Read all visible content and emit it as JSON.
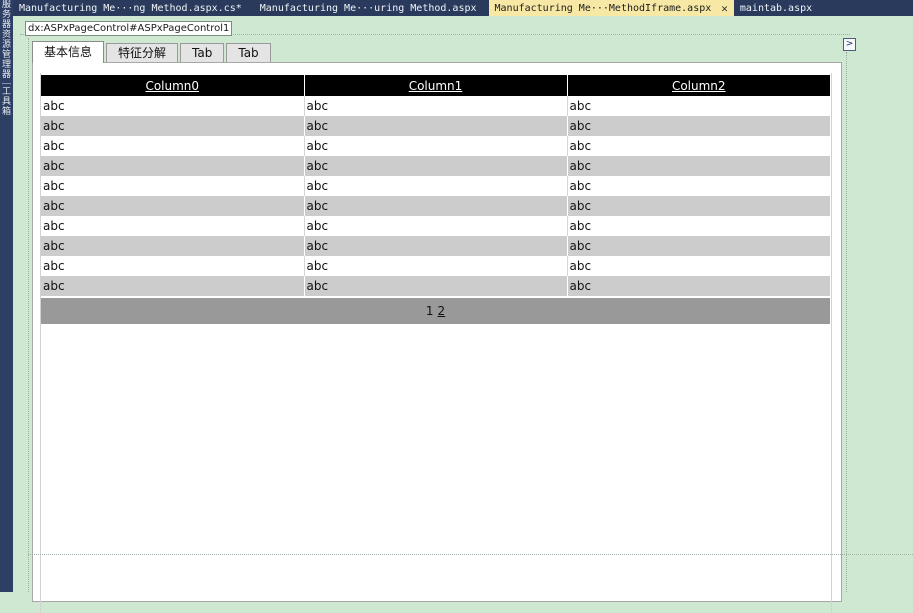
{
  "doc_tabs": [
    {
      "label": "Manufacturing Me···ng Method.aspx.cs*"
    },
    {
      "label": "Manufacturing Me···uring Method.aspx"
    },
    {
      "label": "Manufacturing Me···MethodIframe.aspx",
      "close": "✕"
    },
    {
      "label": "maintab.aspx"
    }
  ],
  "left_strip": {
    "glyphs": [
      "服",
      "务",
      "器",
      "资",
      "源",
      "管",
      "理",
      "器",
      "工",
      "具",
      "箱"
    ]
  },
  "design": {
    "control_label": "dx:ASPxPageControl#ASPxPageControl1",
    "smart_tag": ">"
  },
  "page_control": {
    "tabs": [
      "基本信息",
      "特征分解",
      "Tab",
      "Tab"
    ]
  },
  "grid": {
    "columns": [
      "Column0",
      "Column1",
      "Column2"
    ],
    "rows": [
      [
        "abc",
        "abc",
        "abc"
      ],
      [
        "abc",
        "abc",
        "abc"
      ],
      [
        "abc",
        "abc",
        "abc"
      ],
      [
        "abc",
        "abc",
        "abc"
      ],
      [
        "abc",
        "abc",
        "abc"
      ],
      [
        "abc",
        "abc",
        "abc"
      ],
      [
        "abc",
        "abc",
        "abc"
      ],
      [
        "abc",
        "abc",
        "abc"
      ],
      [
        "abc",
        "abc",
        "abc"
      ],
      [
        "abc",
        "abc",
        "abc"
      ]
    ],
    "pager": {
      "current": "1",
      "next": "2"
    }
  }
}
